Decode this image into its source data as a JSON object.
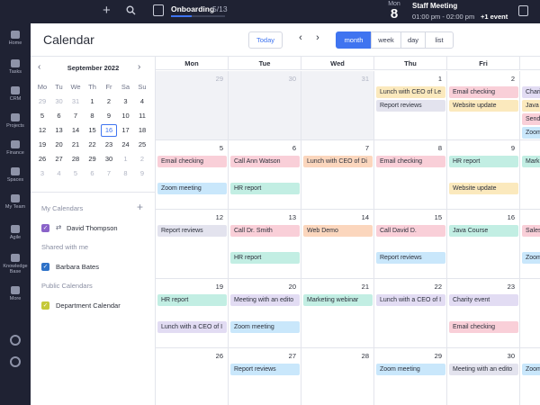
{
  "colors": {
    "accent": "#3f74f0",
    "nav_bg": "#1f2233",
    "event_purple": "#e2dcf3",
    "event_pink": "#f9cfd8",
    "event_orange": "#fbd6bd",
    "event_yellow": "#fbe9bd",
    "event_teal": "#c2eee3",
    "event_blue": "#c9e7fb",
    "event_gray": "#e3e3ee",
    "cal_purple": "#8a63c9",
    "cal_blue": "#2e72c8",
    "cal_lime": "#c5c93a"
  },
  "topbar": {
    "add_icon": "plus-icon",
    "search_icon": "search-icon",
    "onboarding_label": "Onboarding",
    "onboarding_count": "5/13",
    "onboarding_progress": 0.38,
    "date_month": "Mon",
    "date_day": "8",
    "event_title": "Staff Meeting",
    "event_time": "01:00 pm - 02:00 pm",
    "event_more": "+1 event",
    "notes_icon": "notes-icon"
  },
  "nav": {
    "items": [
      {
        "label": "Home",
        "icon": "home-icon"
      },
      {
        "label": "Tasks",
        "icon": "tasks-icon"
      },
      {
        "label": "CRM",
        "icon": "crm-icon"
      },
      {
        "label": "Projects",
        "icon": "projects-icon"
      },
      {
        "label": "Finance",
        "icon": "finance-icon"
      },
      {
        "label": "Spaces",
        "icon": "spaces-icon"
      },
      {
        "label": "My Team",
        "icon": "team-icon"
      },
      {
        "label": "Agile",
        "icon": "agile-icon"
      },
      {
        "label": "Knowledge Base",
        "icon": "knowledge-icon"
      },
      {
        "label": "More",
        "icon": "more-icon"
      }
    ]
  },
  "header": {
    "title": "Calendar",
    "today": "Today",
    "prev": "‹",
    "next": "›",
    "views": [
      "month",
      "week",
      "day",
      "list"
    ],
    "active_view": "month"
  },
  "mini": {
    "title": "September 2022",
    "prev": "‹",
    "next": "›",
    "dow": [
      "Mo",
      "Tu",
      "We",
      "Th",
      "Fr",
      "Sa",
      "Su"
    ],
    "weeks": [
      [
        "29",
        "30",
        "31",
        "1",
        "2",
        "3",
        "4"
      ],
      [
        "5",
        "6",
        "7",
        "8",
        "9",
        "10",
        "11"
      ],
      [
        "12",
        "13",
        "14",
        "15",
        "16",
        "17",
        "18"
      ],
      [
        "19",
        "20",
        "21",
        "22",
        "23",
        "24",
        "25"
      ],
      [
        "26",
        "27",
        "28",
        "29",
        "30",
        "1",
        "2"
      ],
      [
        "3",
        "4",
        "5",
        "6",
        "7",
        "8",
        "9"
      ]
    ],
    "today": "16"
  },
  "sidebar": {
    "my_calendars_label": "My Calendars",
    "my_calendars": [
      {
        "name": "David Thompson",
        "color": "#8a63c9"
      }
    ],
    "shared_label": "Shared with me",
    "shared": [
      {
        "name": "Barbara Bates",
        "color": "#2e72c8"
      }
    ],
    "public_label": "Public Calendars",
    "public": [
      {
        "name": "Department Calendar",
        "color": "#c5c93a"
      }
    ]
  },
  "calendar": {
    "columns": [
      "Mon",
      "Tue",
      "Wed",
      "Thu",
      "Fri"
    ],
    "weeks": [
      {
        "days": [
          {
            "num": "29",
            "out": true,
            "events": []
          },
          {
            "num": "30",
            "out": true,
            "events": []
          },
          {
            "num": "31",
            "out": true,
            "events": []
          },
          {
            "num": "1",
            "out": false,
            "events": [
              {
                "text": "Lunch with CEO of Le",
                "color": "#fbe9bd"
              },
              {
                "text": "Report reviews",
                "color": "#e3e3ee"
              }
            ]
          },
          {
            "num": "2",
            "out": false,
            "events": [
              {
                "text": "Email checking",
                "color": "#f9cfd8"
              },
              {
                "text": "Website update",
                "color": "#fbe9bd"
              }
            ]
          }
        ]
      },
      {
        "days": [
          {
            "num": "5",
            "out": false,
            "events": [
              {
                "text": "Email checking",
                "color": "#f9cfd8"
              },
              {
                "text": "Zoom meeting",
                "color": "#c9e7fb",
                "row": 2
              }
            ]
          },
          {
            "num": "6",
            "out": false,
            "events": [
              {
                "text": "Call Ann Watson",
                "color": "#f9cfd8"
              },
              {
                "text": "HR report",
                "color": "#c2eee3",
                "row": 2
              }
            ]
          },
          {
            "num": "7",
            "out": false,
            "events": [
              {
                "text": "Lunch with CEO of Di",
                "color": "#fbd6bd"
              }
            ]
          },
          {
            "num": "8",
            "out": false,
            "events": [
              {
                "text": "Email checking",
                "color": "#f9cfd8"
              }
            ]
          },
          {
            "num": "9",
            "out": false,
            "events": [
              {
                "text": "HR report",
                "color": "#c2eee3"
              },
              {
                "text": "Website update",
                "color": "#fbe9bd",
                "row": 2
              }
            ]
          }
        ]
      },
      {
        "days": [
          {
            "num": "12",
            "out": false,
            "events": [
              {
                "text": "Report reviews",
                "color": "#e3e3ee"
              }
            ]
          },
          {
            "num": "13",
            "out": false,
            "events": [
              {
                "text": "Call Dr. Smith",
                "color": "#f9cfd8"
              },
              {
                "text": "HR report",
                "color": "#c2eee3",
                "row": 2
              }
            ]
          },
          {
            "num": "14",
            "out": false,
            "events": [
              {
                "text": "Web Demo",
                "color": "#fbd6bd"
              }
            ]
          },
          {
            "num": "15",
            "out": false,
            "events": [
              {
                "text": "Call David D.",
                "color": "#f9cfd8"
              },
              {
                "text": "Report reviews",
                "color": "#c9e7fb",
                "row": 2
              }
            ]
          },
          {
            "num": "16",
            "out": false,
            "events": [
              {
                "text": "Java Course",
                "color": "#c2eee3"
              }
            ]
          }
        ]
      },
      {
        "days": [
          {
            "num": "19",
            "out": false,
            "events": [
              {
                "text": "HR report",
                "color": "#c2eee3"
              },
              {
                "text": "Lunch with a CEO of I",
                "color": "#e2dcf3",
                "row": 2
              }
            ]
          },
          {
            "num": "20",
            "out": false,
            "events": [
              {
                "text": "Meeting with an edito",
                "color": "#e2dcf3"
              },
              {
                "text": "Zoom meeting",
                "color": "#c9e7fb",
                "row": 2
              }
            ]
          },
          {
            "num": "21",
            "out": false,
            "events": [
              {
                "text": "Marketing webinar",
                "color": "#c2eee3"
              }
            ]
          },
          {
            "num": "22",
            "out": false,
            "events": [
              {
                "text": "Lunch with a CEO of I",
                "color": "#e2dcf3"
              }
            ]
          },
          {
            "num": "23",
            "out": false,
            "events": [
              {
                "text": "Charity event",
                "color": "#e2dcf3"
              },
              {
                "text": "Email checking",
                "color": "#f9cfd8",
                "row": 2
              }
            ]
          }
        ]
      },
      {
        "days": [
          {
            "num": "26",
            "out": false,
            "events": []
          },
          {
            "num": "27",
            "out": false,
            "events": [
              {
                "text": "Report reviews",
                "color": "#c9e7fb"
              }
            ]
          },
          {
            "num": "28",
            "out": false,
            "events": []
          },
          {
            "num": "29",
            "out": false,
            "events": [
              {
                "text": "Zoom meeting",
                "color": "#c9e7fb"
              }
            ]
          },
          {
            "num": "30",
            "out": false,
            "events": [
              {
                "text": "Meeting with an edito",
                "color": "#e3e3ee"
              }
            ]
          }
        ]
      }
    ],
    "partial_column": [
      {
        "events": [
          {
            "text": "Charity",
            "color": "#e2dcf3"
          },
          {
            "text": "Java",
            "color": "#fbe9bd"
          },
          {
            "text": "Send",
            "color": "#f9cfd8"
          },
          {
            "text": "Zoom",
            "color": "#c9e7fb"
          }
        ]
      },
      {
        "events": [
          {
            "text": "Mark",
            "color": "#c2eee3"
          }
        ]
      },
      {
        "events": [
          {
            "text": "Sales",
            "color": "#f9cfd8"
          },
          {
            "text": "Zoom",
            "color": "#c9e7fb",
            "row": 2
          }
        ]
      },
      {
        "events": [
          {
            "text": "",
            "color": "#ffffff"
          }
        ]
      },
      {
        "events": [
          {
            "text": "Zoom",
            "color": "#c9e7fb"
          }
        ]
      }
    ]
  }
}
